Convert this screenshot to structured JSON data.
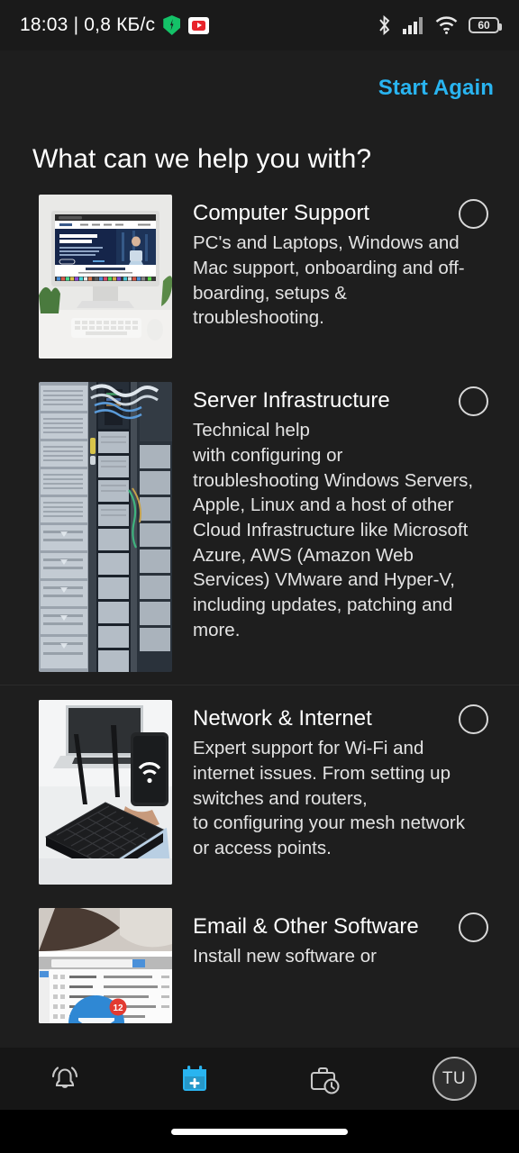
{
  "statusbar": {
    "clock": "18:03 | 0,8 КБ/с",
    "shield_icon": "shield-vpn-icon",
    "media_icon": "youtube-icon",
    "bluetooth_icon": "bluetooth-icon",
    "signal_icon": "cellular-signal-icon",
    "wifi_icon": "wifi-icon",
    "battery_level": "60"
  },
  "header": {
    "start_again_label": "Start Again"
  },
  "main": {
    "page_title": "What can we help you with?",
    "items": [
      {
        "title": "Computer Support",
        "description": "PC's and Laptops, Windows and Mac support, onboarding and off-boarding, setups & troubleshooting.",
        "thumb_name": "imac-desktop-photo",
        "selected": false
      },
      {
        "title": "Server Infrastructure",
        "description": "Technical help\nwith configuring or\ntroubleshooting Windows Servers, Apple, Linux and a host of other Cloud Infrastructure like Microsoft Azure, AWS (Amazon Web Services) VMware and Hyper-V, including updates, patching and more.",
        "thumb_name": "server-rack-photo",
        "selected": false
      },
      {
        "title": "Network & Internet",
        "description": "Expert support for Wi-Fi and internet issues. From setting up switches and routers,\nto configuring your mesh network or access points.",
        "thumb_name": "wifi-router-photo",
        "selected": false
      },
      {
        "title": "Email & Other Software",
        "description": "Install new software or",
        "thumb_name": "email-inbox-photo",
        "selected": false
      }
    ]
  },
  "bottomnav": {
    "items": [
      {
        "icon": "bell-alert-icon",
        "active": false
      },
      {
        "icon": "calendar-plus-icon",
        "active": true
      },
      {
        "icon": "briefcase-clock-icon",
        "active": false
      }
    ],
    "avatar_initials": "TU"
  },
  "colors": {
    "accent": "#29b4f0",
    "background": "#1e1e1e",
    "navbar": "#161616",
    "text_primary": "#ffffff",
    "text_secondary": "#e3e3e3"
  }
}
